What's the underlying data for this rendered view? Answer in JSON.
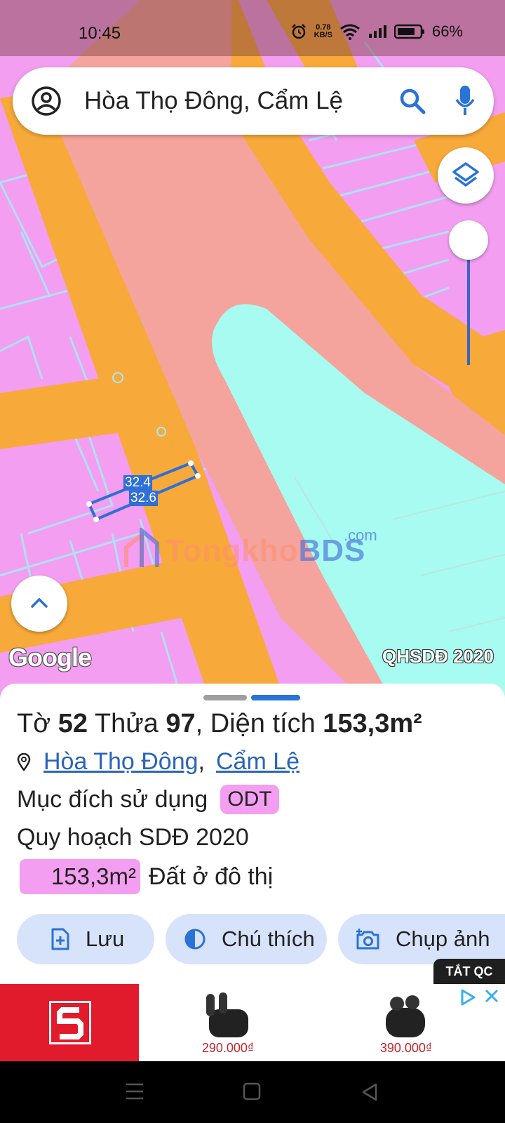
{
  "status_bar": {
    "time": "10:45",
    "speed_value": "0.78",
    "speed_unit": "KB/S",
    "battery": "66%"
  },
  "search": {
    "query": "Hòa Thọ Đông, Cẩm Lệ"
  },
  "map": {
    "parcel_labels": [
      "32.4",
      "32.6"
    ],
    "watermark_part1": "Tongkho",
    "watermark_part2": "BDS",
    "watermark_suffix": ".com",
    "provider": "Google",
    "layer_tag": "QHSDĐ 2020",
    "colors": {
      "residential": "#f39ef0",
      "road": "#f7a93a",
      "river_corridor": "#f4a49c",
      "water": "#a8fbf0"
    }
  },
  "parcel": {
    "title_prefix": "Tờ ",
    "sheet_no": "52",
    "title_mid": " Thửa ",
    "plot_no": "97",
    "title_area_label": ", Diện tích ",
    "area": "153,3m²",
    "ward": "Hòa Thọ Đông",
    "separator": ",",
    "district": "Cẩm Lệ",
    "purpose_label": "Mục đích sử dụng",
    "purpose_code": "ODT",
    "plan_label": "Quy hoạch SDĐ 2020",
    "plan_area": "153,3m²",
    "plan_type": "Đất ở đô thị"
  },
  "actions": {
    "save": "Lưu",
    "legend": "Chú thích",
    "capture": "Chụp ảnh"
  },
  "ad": {
    "close_tag": "TẮT QC",
    "product1_price": "290.000₫",
    "product2_price": "390.000₫"
  },
  "icons": {
    "account": "account-circle-icon",
    "search": "search-icon",
    "mic": "mic-icon",
    "layers": "layers-icon",
    "expand": "chevron-up-icon",
    "location": "location-pin-icon",
    "save": "add-file-icon",
    "legend": "contrast-icon",
    "capture": "camera-icon"
  }
}
